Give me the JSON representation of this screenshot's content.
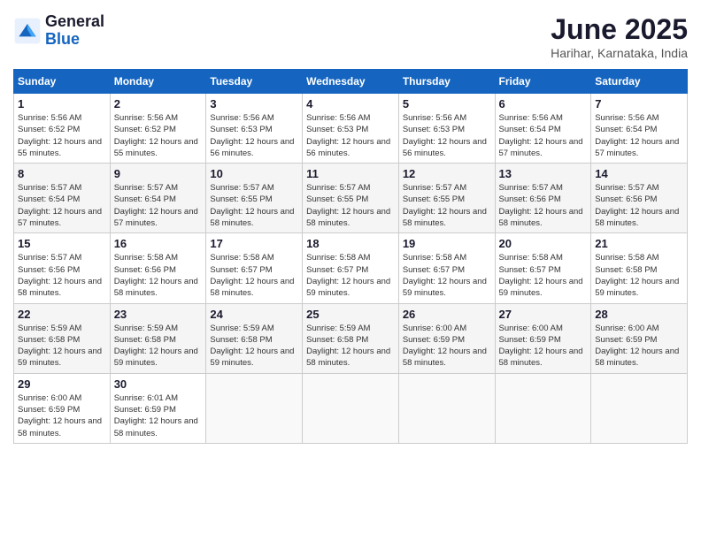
{
  "logo": {
    "line1": "General",
    "line2": "Blue"
  },
  "title": "June 2025",
  "location": "Harihar, Karnataka, India",
  "days_header": [
    "Sunday",
    "Monday",
    "Tuesday",
    "Wednesday",
    "Thursday",
    "Friday",
    "Saturday"
  ],
  "weeks": [
    [
      {
        "day": "1",
        "sunrise": "5:56 AM",
        "sunset": "6:52 PM",
        "daylight": "12 hours and 55 minutes."
      },
      {
        "day": "2",
        "sunrise": "5:56 AM",
        "sunset": "6:52 PM",
        "daylight": "12 hours and 55 minutes."
      },
      {
        "day": "3",
        "sunrise": "5:56 AM",
        "sunset": "6:53 PM",
        "daylight": "12 hours and 56 minutes."
      },
      {
        "day": "4",
        "sunrise": "5:56 AM",
        "sunset": "6:53 PM",
        "daylight": "12 hours and 56 minutes."
      },
      {
        "day": "5",
        "sunrise": "5:56 AM",
        "sunset": "6:53 PM",
        "daylight": "12 hours and 56 minutes."
      },
      {
        "day": "6",
        "sunrise": "5:56 AM",
        "sunset": "6:54 PM",
        "daylight": "12 hours and 57 minutes."
      },
      {
        "day": "7",
        "sunrise": "5:56 AM",
        "sunset": "6:54 PM",
        "daylight": "12 hours and 57 minutes."
      }
    ],
    [
      {
        "day": "8",
        "sunrise": "5:57 AM",
        "sunset": "6:54 PM",
        "daylight": "12 hours and 57 minutes."
      },
      {
        "day": "9",
        "sunrise": "5:57 AM",
        "sunset": "6:54 PM",
        "daylight": "12 hours and 57 minutes."
      },
      {
        "day": "10",
        "sunrise": "5:57 AM",
        "sunset": "6:55 PM",
        "daylight": "12 hours and 58 minutes."
      },
      {
        "day": "11",
        "sunrise": "5:57 AM",
        "sunset": "6:55 PM",
        "daylight": "12 hours and 58 minutes."
      },
      {
        "day": "12",
        "sunrise": "5:57 AM",
        "sunset": "6:55 PM",
        "daylight": "12 hours and 58 minutes."
      },
      {
        "day": "13",
        "sunrise": "5:57 AM",
        "sunset": "6:56 PM",
        "daylight": "12 hours and 58 minutes."
      },
      {
        "day": "14",
        "sunrise": "5:57 AM",
        "sunset": "6:56 PM",
        "daylight": "12 hours and 58 minutes."
      }
    ],
    [
      {
        "day": "15",
        "sunrise": "5:57 AM",
        "sunset": "6:56 PM",
        "daylight": "12 hours and 58 minutes."
      },
      {
        "day": "16",
        "sunrise": "5:58 AM",
        "sunset": "6:56 PM",
        "daylight": "12 hours and 58 minutes."
      },
      {
        "day": "17",
        "sunrise": "5:58 AM",
        "sunset": "6:57 PM",
        "daylight": "12 hours and 58 minutes."
      },
      {
        "day": "18",
        "sunrise": "5:58 AM",
        "sunset": "6:57 PM",
        "daylight": "12 hours and 59 minutes."
      },
      {
        "day": "19",
        "sunrise": "5:58 AM",
        "sunset": "6:57 PM",
        "daylight": "12 hours and 59 minutes."
      },
      {
        "day": "20",
        "sunrise": "5:58 AM",
        "sunset": "6:57 PM",
        "daylight": "12 hours and 59 minutes."
      },
      {
        "day": "21",
        "sunrise": "5:58 AM",
        "sunset": "6:58 PM",
        "daylight": "12 hours and 59 minutes."
      }
    ],
    [
      {
        "day": "22",
        "sunrise": "5:59 AM",
        "sunset": "6:58 PM",
        "daylight": "12 hours and 59 minutes."
      },
      {
        "day": "23",
        "sunrise": "5:59 AM",
        "sunset": "6:58 PM",
        "daylight": "12 hours and 59 minutes."
      },
      {
        "day": "24",
        "sunrise": "5:59 AM",
        "sunset": "6:58 PM",
        "daylight": "12 hours and 59 minutes."
      },
      {
        "day": "25",
        "sunrise": "5:59 AM",
        "sunset": "6:58 PM",
        "daylight": "12 hours and 58 minutes."
      },
      {
        "day": "26",
        "sunrise": "6:00 AM",
        "sunset": "6:59 PM",
        "daylight": "12 hours and 58 minutes."
      },
      {
        "day": "27",
        "sunrise": "6:00 AM",
        "sunset": "6:59 PM",
        "daylight": "12 hours and 58 minutes."
      },
      {
        "day": "28",
        "sunrise": "6:00 AM",
        "sunset": "6:59 PM",
        "daylight": "12 hours and 58 minutes."
      }
    ],
    [
      {
        "day": "29",
        "sunrise": "6:00 AM",
        "sunset": "6:59 PM",
        "daylight": "12 hours and 58 minutes."
      },
      {
        "day": "30",
        "sunrise": "6:01 AM",
        "sunset": "6:59 PM",
        "daylight": "12 hours and 58 minutes."
      },
      null,
      null,
      null,
      null,
      null
    ]
  ]
}
